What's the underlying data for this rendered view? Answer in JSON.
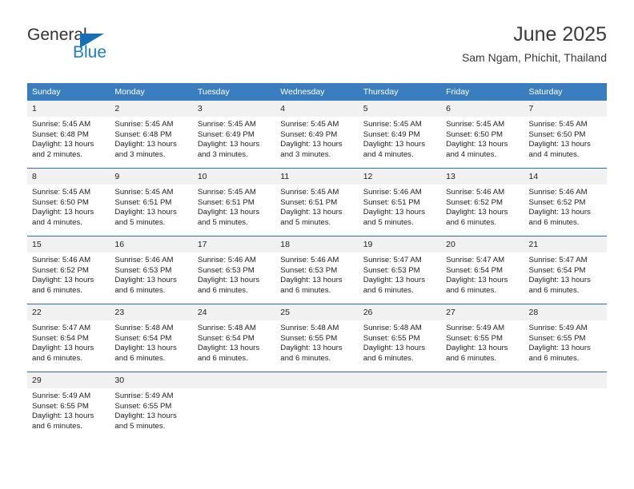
{
  "brand": {
    "name_top": "General",
    "name_bottom": "Blue",
    "color_dark": "#333333",
    "color_blue": "#1a7ec8",
    "triangle_color": "#176fb5"
  },
  "header": {
    "title": "June 2025",
    "subtitle": "Sam Ngam, Phichit, Thailand"
  },
  "theme": {
    "header_row_bg": "#3a7ebf",
    "row_divider": "#2f6da8",
    "daynum_bg": "#f1f1f1",
    "text": "#222222"
  },
  "labels": {
    "sunrise": "Sunrise:",
    "sunset": "Sunset:",
    "daylight": "Daylight:"
  },
  "weekdays": [
    "Sunday",
    "Monday",
    "Tuesday",
    "Wednesday",
    "Thursday",
    "Friday",
    "Saturday"
  ],
  "weeks": [
    [
      {
        "day": "1",
        "sunrise": "Sunrise: 5:45 AM",
        "sunset": "Sunset: 6:48 PM",
        "daylight_1": "Daylight: 13 hours",
        "daylight_2": "and 2 minutes."
      },
      {
        "day": "2",
        "sunrise": "Sunrise: 5:45 AM",
        "sunset": "Sunset: 6:48 PM",
        "daylight_1": "Daylight: 13 hours",
        "daylight_2": "and 3 minutes."
      },
      {
        "day": "3",
        "sunrise": "Sunrise: 5:45 AM",
        "sunset": "Sunset: 6:49 PM",
        "daylight_1": "Daylight: 13 hours",
        "daylight_2": "and 3 minutes."
      },
      {
        "day": "4",
        "sunrise": "Sunrise: 5:45 AM",
        "sunset": "Sunset: 6:49 PM",
        "daylight_1": "Daylight: 13 hours",
        "daylight_2": "and 3 minutes."
      },
      {
        "day": "5",
        "sunrise": "Sunrise: 5:45 AM",
        "sunset": "Sunset: 6:49 PM",
        "daylight_1": "Daylight: 13 hours",
        "daylight_2": "and 4 minutes."
      },
      {
        "day": "6",
        "sunrise": "Sunrise: 5:45 AM",
        "sunset": "Sunset: 6:50 PM",
        "daylight_1": "Daylight: 13 hours",
        "daylight_2": "and 4 minutes."
      },
      {
        "day": "7",
        "sunrise": "Sunrise: 5:45 AM",
        "sunset": "Sunset: 6:50 PM",
        "daylight_1": "Daylight: 13 hours",
        "daylight_2": "and 4 minutes."
      }
    ],
    [
      {
        "day": "8",
        "sunrise": "Sunrise: 5:45 AM",
        "sunset": "Sunset: 6:50 PM",
        "daylight_1": "Daylight: 13 hours",
        "daylight_2": "and 4 minutes."
      },
      {
        "day": "9",
        "sunrise": "Sunrise: 5:45 AM",
        "sunset": "Sunset: 6:51 PM",
        "daylight_1": "Daylight: 13 hours",
        "daylight_2": "and 5 minutes."
      },
      {
        "day": "10",
        "sunrise": "Sunrise: 5:45 AM",
        "sunset": "Sunset: 6:51 PM",
        "daylight_1": "Daylight: 13 hours",
        "daylight_2": "and 5 minutes."
      },
      {
        "day": "11",
        "sunrise": "Sunrise: 5:45 AM",
        "sunset": "Sunset: 6:51 PM",
        "daylight_1": "Daylight: 13 hours",
        "daylight_2": "and 5 minutes."
      },
      {
        "day": "12",
        "sunrise": "Sunrise: 5:46 AM",
        "sunset": "Sunset: 6:51 PM",
        "daylight_1": "Daylight: 13 hours",
        "daylight_2": "and 5 minutes."
      },
      {
        "day": "13",
        "sunrise": "Sunrise: 5:46 AM",
        "sunset": "Sunset: 6:52 PM",
        "daylight_1": "Daylight: 13 hours",
        "daylight_2": "and 6 minutes."
      },
      {
        "day": "14",
        "sunrise": "Sunrise: 5:46 AM",
        "sunset": "Sunset: 6:52 PM",
        "daylight_1": "Daylight: 13 hours",
        "daylight_2": "and 6 minutes."
      }
    ],
    [
      {
        "day": "15",
        "sunrise": "Sunrise: 5:46 AM",
        "sunset": "Sunset: 6:52 PM",
        "daylight_1": "Daylight: 13 hours",
        "daylight_2": "and 6 minutes."
      },
      {
        "day": "16",
        "sunrise": "Sunrise: 5:46 AM",
        "sunset": "Sunset: 6:53 PM",
        "daylight_1": "Daylight: 13 hours",
        "daylight_2": "and 6 minutes."
      },
      {
        "day": "17",
        "sunrise": "Sunrise: 5:46 AM",
        "sunset": "Sunset: 6:53 PM",
        "daylight_1": "Daylight: 13 hours",
        "daylight_2": "and 6 minutes."
      },
      {
        "day": "18",
        "sunrise": "Sunrise: 5:46 AM",
        "sunset": "Sunset: 6:53 PM",
        "daylight_1": "Daylight: 13 hours",
        "daylight_2": "and 6 minutes."
      },
      {
        "day": "19",
        "sunrise": "Sunrise: 5:47 AM",
        "sunset": "Sunset: 6:53 PM",
        "daylight_1": "Daylight: 13 hours",
        "daylight_2": "and 6 minutes."
      },
      {
        "day": "20",
        "sunrise": "Sunrise: 5:47 AM",
        "sunset": "Sunset: 6:54 PM",
        "daylight_1": "Daylight: 13 hours",
        "daylight_2": "and 6 minutes."
      },
      {
        "day": "21",
        "sunrise": "Sunrise: 5:47 AM",
        "sunset": "Sunset: 6:54 PM",
        "daylight_1": "Daylight: 13 hours",
        "daylight_2": "and 6 minutes."
      }
    ],
    [
      {
        "day": "22",
        "sunrise": "Sunrise: 5:47 AM",
        "sunset": "Sunset: 6:54 PM",
        "daylight_1": "Daylight: 13 hours",
        "daylight_2": "and 6 minutes."
      },
      {
        "day": "23",
        "sunrise": "Sunrise: 5:48 AM",
        "sunset": "Sunset: 6:54 PM",
        "daylight_1": "Daylight: 13 hours",
        "daylight_2": "and 6 minutes."
      },
      {
        "day": "24",
        "sunrise": "Sunrise: 5:48 AM",
        "sunset": "Sunset: 6:54 PM",
        "daylight_1": "Daylight: 13 hours",
        "daylight_2": "and 6 minutes."
      },
      {
        "day": "25",
        "sunrise": "Sunrise: 5:48 AM",
        "sunset": "Sunset: 6:55 PM",
        "daylight_1": "Daylight: 13 hours",
        "daylight_2": "and 6 minutes."
      },
      {
        "day": "26",
        "sunrise": "Sunrise: 5:48 AM",
        "sunset": "Sunset: 6:55 PM",
        "daylight_1": "Daylight: 13 hours",
        "daylight_2": "and 6 minutes."
      },
      {
        "day": "27",
        "sunrise": "Sunrise: 5:49 AM",
        "sunset": "Sunset: 6:55 PM",
        "daylight_1": "Daylight: 13 hours",
        "daylight_2": "and 6 minutes."
      },
      {
        "day": "28",
        "sunrise": "Sunrise: 5:49 AM",
        "sunset": "Sunset: 6:55 PM",
        "daylight_1": "Daylight: 13 hours",
        "daylight_2": "and 6 minutes."
      }
    ],
    [
      {
        "day": "29",
        "sunrise": "Sunrise: 5:49 AM",
        "sunset": "Sunset: 6:55 PM",
        "daylight_1": "Daylight: 13 hours",
        "daylight_2": "and 6 minutes."
      },
      {
        "day": "30",
        "sunrise": "Sunrise: 5:49 AM",
        "sunset": "Sunset: 6:55 PM",
        "daylight_1": "Daylight: 13 hours",
        "daylight_2": "and 5 minutes."
      },
      {
        "day": "",
        "sunrise": "",
        "sunset": "",
        "daylight_1": "",
        "daylight_2": ""
      },
      {
        "day": "",
        "sunrise": "",
        "sunset": "",
        "daylight_1": "",
        "daylight_2": ""
      },
      {
        "day": "",
        "sunrise": "",
        "sunset": "",
        "daylight_1": "",
        "daylight_2": ""
      },
      {
        "day": "",
        "sunrise": "",
        "sunset": "",
        "daylight_1": "",
        "daylight_2": ""
      },
      {
        "day": "",
        "sunrise": "",
        "sunset": "",
        "daylight_1": "",
        "daylight_2": ""
      }
    ]
  ]
}
